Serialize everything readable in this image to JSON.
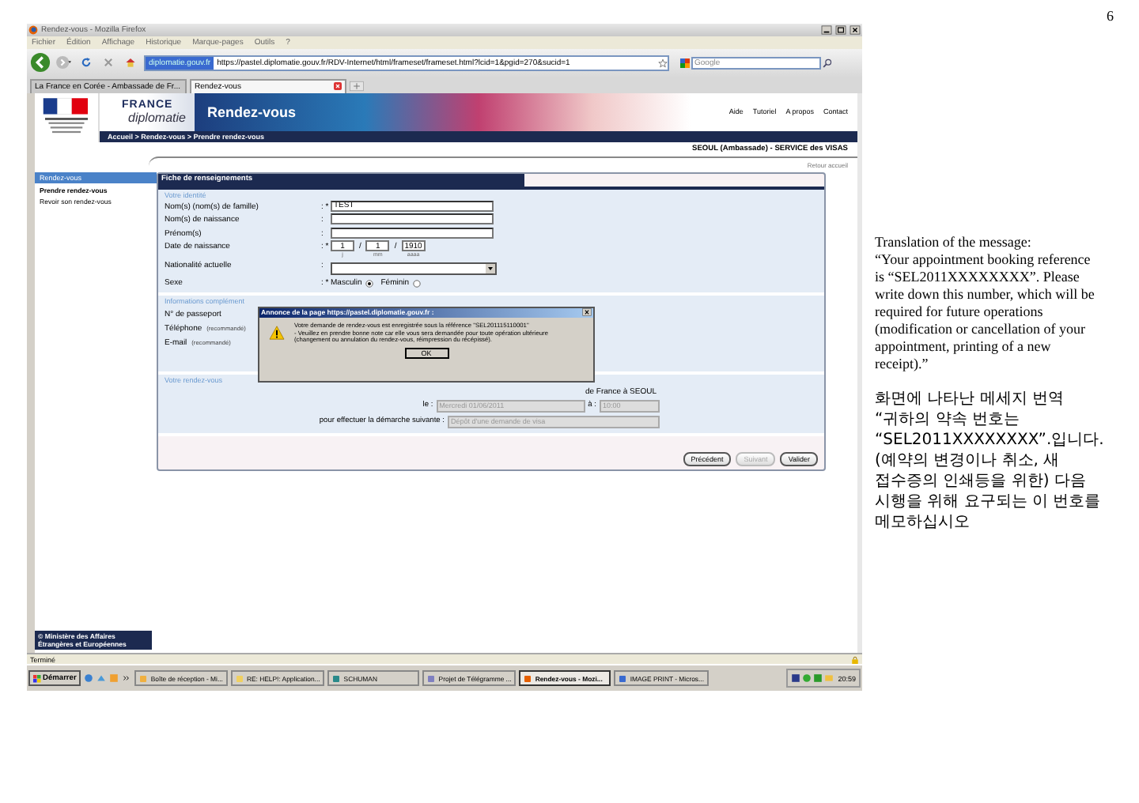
{
  "document": {
    "page_number": "6",
    "heading": "Translation of the message:",
    "english_lines": [
      "“Your appointment booking reference",
      "is “SEL2011XXXXXXXX”. Please",
      "write down this number, which will be",
      "required for future operations",
      "(modification or cancellation of your",
      "appointment, printing of a new",
      "receipt).”"
    ],
    "korean_lines": [
      "화면에 나타난 메세지 번역",
      "“귀하의 약속 번호는",
      "“SEL2011XXXXXXXX”.입니다.",
      "(예약의 변경이나 취소, 새",
      "접수증의 인쇄등을 위한) 다음",
      "시행을 위해 요구되는 이 번호를",
      "메모하십시오"
    ]
  },
  "browser": {
    "title": "Rendez-vous - Mozilla Firefox",
    "menu": [
      "Fichier",
      "Édition",
      "Affichage",
      "Historique",
      "Marque-pages",
      "Outils",
      "?"
    ],
    "url_site": "diplomatie.gouv.fr",
    "url": "https://pastel.diplomatie.gouv.fr/RDV-Internet/html/frameset/frameset.html?lcid=1&pgid=270&sucid=1",
    "search_placeholder": "Google",
    "tabs": [
      {
        "label": "La France en Corée - Ambassade de Fr...",
        "selected": false
      },
      {
        "label": "Rendez-vous",
        "selected": true
      }
    ],
    "status": "Terminé"
  },
  "site": {
    "brand_top": "FRANCE",
    "brand_bottom": "diplomatie",
    "banner_title": "Rendez-vous",
    "links": [
      "Aide",
      "Tutoriel",
      "A propos",
      "Contact"
    ],
    "breadcrumb": "Accueil > Rendez-vous > Prendre rendez-vous",
    "location": "SEOUL (Ambassade) - SERVICE des VISAS",
    "home_link": "Retour accueil"
  },
  "sidebar": {
    "header": "Rendez-vous",
    "items": [
      {
        "label": "Prendre rendez-vous",
        "selected": true
      },
      {
        "label": "Revoir son rendez-vous",
        "selected": false
      }
    ],
    "footer": "© Ministère des Affaires Étrangères et Européennes"
  },
  "form": {
    "title": "Fiche de renseignements",
    "identity": {
      "heading": "Votre identité",
      "fields": [
        {
          "kind": "text",
          "label": "Nom(s) (nom(s) de famille)",
          "colon": ": *",
          "value": "TEST"
        },
        {
          "kind": "text",
          "label": "Nom(s) de naissance",
          "colon": ":"
        },
        {
          "kind": "text",
          "label": "Prénom(s)",
          "colon": ":"
        },
        {
          "kind": "date",
          "label": "Date de naissance",
          "colon": ": *",
          "separator": "/",
          "parts": [
            {
              "value": "1",
              "hint": "j"
            },
            {
              "value": "1",
              "hint": "mm"
            },
            {
              "value": "1910",
              "hint": "aaaa"
            }
          ]
        },
        {
          "kind": "select",
          "label": "Nationalité actuelle",
          "colon": ":"
        },
        {
          "kind": "radio",
          "label": "Sexe",
          "colon": ": *",
          "options": [
            {
              "label": "Masculin",
              "selected": true
            },
            {
              "label": "Féminin",
              "selected": false
            }
          ]
        }
      ]
    },
    "extra": {
      "heading": "Informations complément",
      "fields": [
        {
          "label": "N° de passeport"
        },
        {
          "label": "Téléphone",
          "note": "(recommandé)"
        },
        {
          "label": "E-mail",
          "note": "(recommandé)"
        }
      ]
    },
    "appointment": {
      "heading": "Votre rendez-vous",
      "place": "de France à SEOUL",
      "date_label": "le :",
      "date_value": "Mercredi 01/06/2011",
      "time_label": "à :",
      "time_value": "10:00",
      "procedure_label": "pour effectuer la démarche suivante :",
      "procedure_value": "Dépôt d'une demande de visa"
    },
    "buttons": [
      {
        "label": "Précédent",
        "disabled": false
      },
      {
        "label": "Suivant",
        "disabled": true
      },
      {
        "label": "Valider",
        "disabled": false
      }
    ]
  },
  "dialog": {
    "title": "Annonce de la page https://pastel.diplomatie.gouv.fr :",
    "message": "Votre demande de rendez-vous est enregistrée sous la référence \"SEL201115110001\"",
    "detail": "- Veuillez en prendre bonne note car elle vous sera demandée pour toute opération ultérieure (changement ou annulation du rendez-vous, réimpression du récépissé).",
    "button": "OK"
  },
  "taskbar": {
    "start": "Démarrer",
    "tasks": [
      {
        "label": "Boîte de réception - Mi...",
        "selected": false
      },
      {
        "label": "RE: HELP!: Application...",
        "selected": false
      },
      {
        "label": "SCHUMAN",
        "selected": false
      },
      {
        "label": "Projet de Télégramme ...",
        "selected": false
      },
      {
        "label": "Rendez-vous - Mozi...",
        "selected": true
      },
      {
        "label": "IMAGE PRINT - Micros...",
        "selected": false
      }
    ],
    "clock": "20:59"
  }
}
